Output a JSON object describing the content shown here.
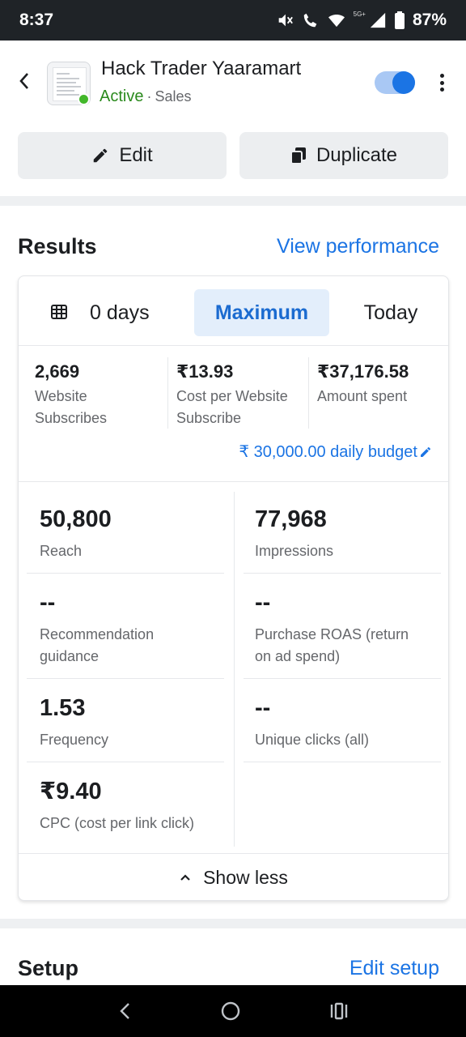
{
  "status_bar": {
    "time": "8:37",
    "network_label": "5G+",
    "battery": "87%"
  },
  "header": {
    "title": "Hack Trader Yaaramart",
    "status": "Active",
    "separator": "·",
    "objective": "Sales",
    "toggle_on": true
  },
  "actions": {
    "edit_label": "Edit",
    "duplicate_label": "Duplicate"
  },
  "results": {
    "title": "Results",
    "link": "View performance",
    "date_ranges": [
      {
        "label": "0 days",
        "selected": false
      },
      {
        "label": "Maximum",
        "selected": true
      },
      {
        "label": "Today",
        "selected": false
      }
    ],
    "summary": [
      {
        "value": "2,669",
        "label_1": "Website",
        "label_2": "Subscribes"
      },
      {
        "value": "₹13.93",
        "label_1": "Cost per Website",
        "label_2": "Subscribe"
      },
      {
        "value": "₹37,176.58",
        "label_1": "Amount spent",
        "label_2": ""
      }
    ],
    "budget": "₹ 30,000.00 daily budget",
    "metrics": [
      {
        "value": "50,800",
        "label_1": "Reach",
        "label_2": ""
      },
      {
        "value": "77,968",
        "label_1": "Impressions",
        "label_2": ""
      },
      {
        "value": "--",
        "label_1": "Recommendation",
        "label_2": "guidance"
      },
      {
        "value": "--",
        "label_1": "Purchase ROAS (return",
        "label_2": "on ad spend)"
      },
      {
        "value": "1.53",
        "label_1": "Frequency",
        "label_2": ""
      },
      {
        "value": "--",
        "label_1": "Unique clicks (all)",
        "label_2": ""
      },
      {
        "value": "₹9.40",
        "label_1": "CPC (cost per link click)",
        "label_2": ""
      }
    ],
    "show_less": "Show less"
  },
  "setup": {
    "title": "Setup",
    "link": "Edit setup"
  },
  "colors": {
    "accent": "#1b74e4",
    "active_green": "#2b8a1e",
    "selected_bg": "#e3eefb"
  }
}
